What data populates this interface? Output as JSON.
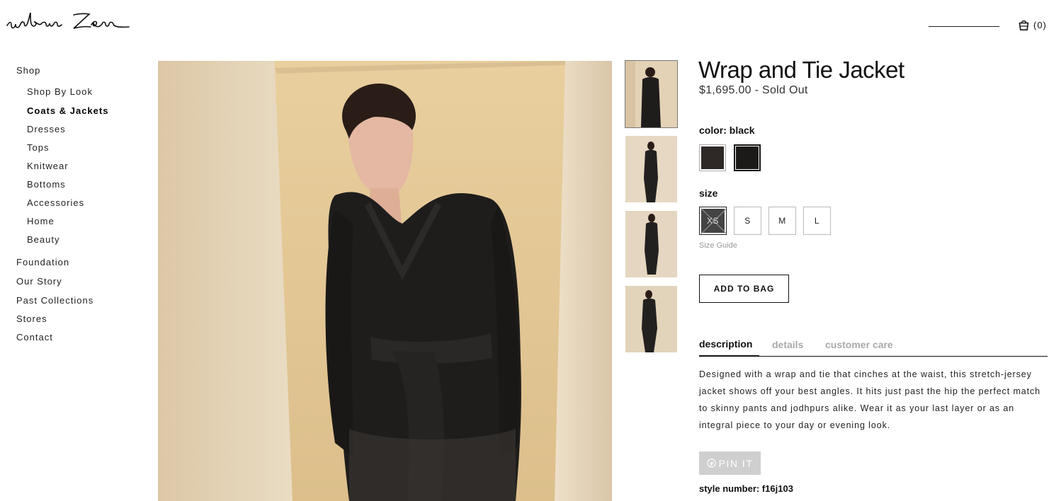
{
  "brand": {
    "logo_text": "urban Zen"
  },
  "header": {
    "cart_count": "(0)",
    "icons": [
      "search-underline",
      "shopping-bag-icon"
    ]
  },
  "sidebar": {
    "items": [
      {
        "label": "Shop",
        "level": 0,
        "active": false
      },
      {
        "label": "Shop By Look",
        "level": 1,
        "active": false
      },
      {
        "label": "Coats & Jackets",
        "level": 1,
        "active": true
      },
      {
        "label": "Dresses",
        "level": 1,
        "active": false
      },
      {
        "label": "Tops",
        "level": 1,
        "active": false
      },
      {
        "label": "Knitwear",
        "level": 1,
        "active": false
      },
      {
        "label": "Bottoms",
        "level": 1,
        "active": false
      },
      {
        "label": "Accessories",
        "level": 1,
        "active": false
      },
      {
        "label": "Home",
        "level": 1,
        "active": false
      },
      {
        "label": "Beauty",
        "level": 1,
        "active": false
      },
      {
        "label": "Foundation",
        "level": 0,
        "active": false
      },
      {
        "label": "Our Story",
        "level": 0,
        "active": false
      },
      {
        "label": "Past Collections",
        "level": 0,
        "active": false
      },
      {
        "label": "Stores",
        "level": 0,
        "active": false
      },
      {
        "label": "Contact",
        "level": 0,
        "active": false
      }
    ]
  },
  "gallery": {
    "thumbnail_count": 4,
    "selected_thumbnail": 1
  },
  "product": {
    "title": "Wrap and Tie Jacket",
    "price": "$1,695.00 - Sold Out",
    "color_label": "color:",
    "color_value": "black",
    "colors": [
      {
        "name": "charcoal",
        "hex": "#2e2927"
      },
      {
        "name": "black",
        "hex": "#1c1a19",
        "selected": true
      }
    ],
    "size_label": "size",
    "sizes": [
      {
        "label": "XS",
        "sold_out": true
      },
      {
        "label": "S",
        "sold_out": false
      },
      {
        "label": "M",
        "sold_out": false
      },
      {
        "label": "L",
        "sold_out": false
      }
    ],
    "size_guide": "Size Guide",
    "add_to_bag": "ADD TO BAG",
    "tabs": [
      {
        "label": "description",
        "active": true
      },
      {
        "label": "details",
        "active": false
      },
      {
        "label": "customer care",
        "active": false
      }
    ],
    "description": "Designed with a wrap and tie that cinches at the waist, this stretch-jersey jacket shows off your best angles. It hits just past the hip the perfect match to skinny pants and jodhpurs alike. Wear it as your last layer or as an integral piece to your day or evening look.",
    "pin_it": "PIN IT",
    "style_number": "style number: f16j103"
  },
  "colors": {
    "text": "#111111",
    "muted": "#aaaaaa",
    "pin_bg": "#cfcfcf",
    "photo_bg": "#e7d3b3"
  }
}
